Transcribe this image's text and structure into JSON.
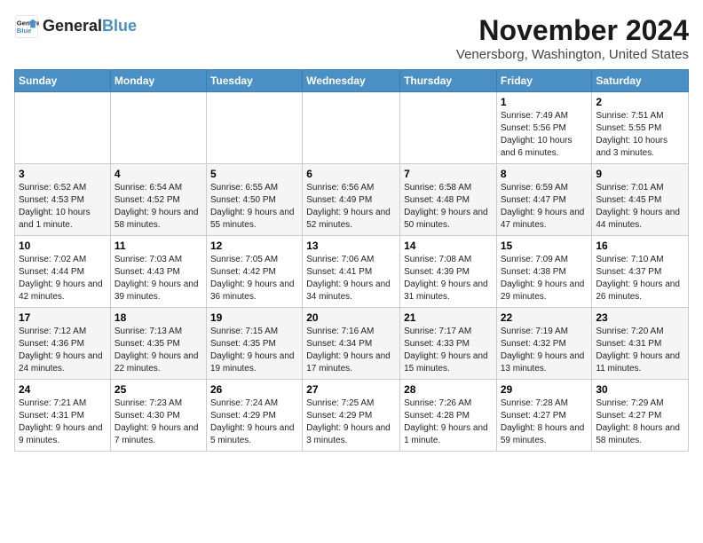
{
  "logo": {
    "line1": "General",
    "line2": "Blue"
  },
  "title": "November 2024",
  "location": "Venersborg, Washington, United States",
  "headers": [
    "Sunday",
    "Monday",
    "Tuesday",
    "Wednesday",
    "Thursday",
    "Friday",
    "Saturday"
  ],
  "weeks": [
    [
      {
        "day": "",
        "info": ""
      },
      {
        "day": "",
        "info": ""
      },
      {
        "day": "",
        "info": ""
      },
      {
        "day": "",
        "info": ""
      },
      {
        "day": "",
        "info": ""
      },
      {
        "day": "1",
        "info": "Sunrise: 7:49 AM\nSunset: 5:56 PM\nDaylight: 10 hours and 6 minutes."
      },
      {
        "day": "2",
        "info": "Sunrise: 7:51 AM\nSunset: 5:55 PM\nDaylight: 10 hours and 3 minutes."
      }
    ],
    [
      {
        "day": "3",
        "info": "Sunrise: 6:52 AM\nSunset: 4:53 PM\nDaylight: 10 hours and 1 minute."
      },
      {
        "day": "4",
        "info": "Sunrise: 6:54 AM\nSunset: 4:52 PM\nDaylight: 9 hours and 58 minutes."
      },
      {
        "day": "5",
        "info": "Sunrise: 6:55 AM\nSunset: 4:50 PM\nDaylight: 9 hours and 55 minutes."
      },
      {
        "day": "6",
        "info": "Sunrise: 6:56 AM\nSunset: 4:49 PM\nDaylight: 9 hours and 52 minutes."
      },
      {
        "day": "7",
        "info": "Sunrise: 6:58 AM\nSunset: 4:48 PM\nDaylight: 9 hours and 50 minutes."
      },
      {
        "day": "8",
        "info": "Sunrise: 6:59 AM\nSunset: 4:47 PM\nDaylight: 9 hours and 47 minutes."
      },
      {
        "day": "9",
        "info": "Sunrise: 7:01 AM\nSunset: 4:45 PM\nDaylight: 9 hours and 44 minutes."
      }
    ],
    [
      {
        "day": "10",
        "info": "Sunrise: 7:02 AM\nSunset: 4:44 PM\nDaylight: 9 hours and 42 minutes."
      },
      {
        "day": "11",
        "info": "Sunrise: 7:03 AM\nSunset: 4:43 PM\nDaylight: 9 hours and 39 minutes."
      },
      {
        "day": "12",
        "info": "Sunrise: 7:05 AM\nSunset: 4:42 PM\nDaylight: 9 hours and 36 minutes."
      },
      {
        "day": "13",
        "info": "Sunrise: 7:06 AM\nSunset: 4:41 PM\nDaylight: 9 hours and 34 minutes."
      },
      {
        "day": "14",
        "info": "Sunrise: 7:08 AM\nSunset: 4:39 PM\nDaylight: 9 hours and 31 minutes."
      },
      {
        "day": "15",
        "info": "Sunrise: 7:09 AM\nSunset: 4:38 PM\nDaylight: 9 hours and 29 minutes."
      },
      {
        "day": "16",
        "info": "Sunrise: 7:10 AM\nSunset: 4:37 PM\nDaylight: 9 hours and 26 minutes."
      }
    ],
    [
      {
        "day": "17",
        "info": "Sunrise: 7:12 AM\nSunset: 4:36 PM\nDaylight: 9 hours and 24 minutes."
      },
      {
        "day": "18",
        "info": "Sunrise: 7:13 AM\nSunset: 4:35 PM\nDaylight: 9 hours and 22 minutes."
      },
      {
        "day": "19",
        "info": "Sunrise: 7:15 AM\nSunset: 4:35 PM\nDaylight: 9 hours and 19 minutes."
      },
      {
        "day": "20",
        "info": "Sunrise: 7:16 AM\nSunset: 4:34 PM\nDaylight: 9 hours and 17 minutes."
      },
      {
        "day": "21",
        "info": "Sunrise: 7:17 AM\nSunset: 4:33 PM\nDaylight: 9 hours and 15 minutes."
      },
      {
        "day": "22",
        "info": "Sunrise: 7:19 AM\nSunset: 4:32 PM\nDaylight: 9 hours and 13 minutes."
      },
      {
        "day": "23",
        "info": "Sunrise: 7:20 AM\nSunset: 4:31 PM\nDaylight: 9 hours and 11 minutes."
      }
    ],
    [
      {
        "day": "24",
        "info": "Sunrise: 7:21 AM\nSunset: 4:31 PM\nDaylight: 9 hours and 9 minutes."
      },
      {
        "day": "25",
        "info": "Sunrise: 7:23 AM\nSunset: 4:30 PM\nDaylight: 9 hours and 7 minutes."
      },
      {
        "day": "26",
        "info": "Sunrise: 7:24 AM\nSunset: 4:29 PM\nDaylight: 9 hours and 5 minutes."
      },
      {
        "day": "27",
        "info": "Sunrise: 7:25 AM\nSunset: 4:29 PM\nDaylight: 9 hours and 3 minutes."
      },
      {
        "day": "28",
        "info": "Sunrise: 7:26 AM\nSunset: 4:28 PM\nDaylight: 9 hours and 1 minute."
      },
      {
        "day": "29",
        "info": "Sunrise: 7:28 AM\nSunset: 4:27 PM\nDaylight: 8 hours and 59 minutes."
      },
      {
        "day": "30",
        "info": "Sunrise: 7:29 AM\nSunset: 4:27 PM\nDaylight: 8 hours and 58 minutes."
      }
    ]
  ]
}
